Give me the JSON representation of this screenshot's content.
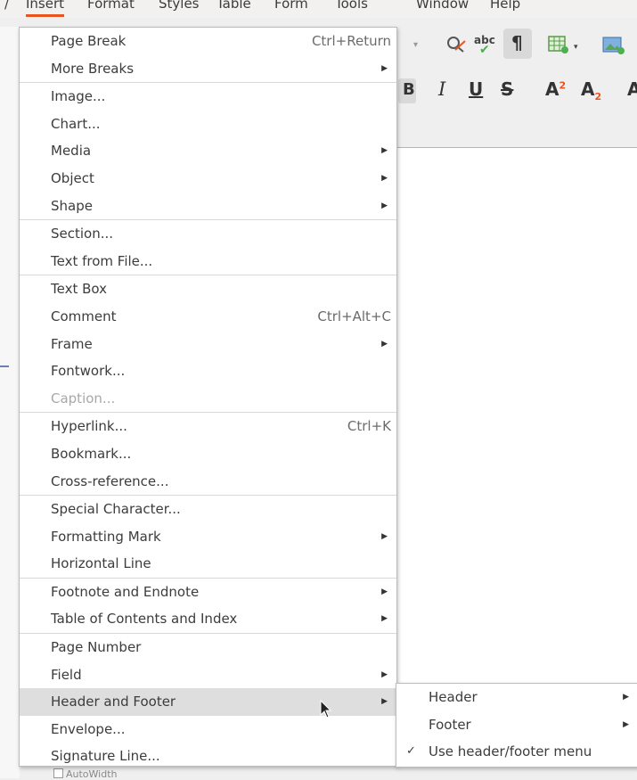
{
  "menubar": {
    "items": [
      {
        "label": "/"
      },
      {
        "label": "Insert"
      },
      {
        "label": "Format"
      },
      {
        "label": "Styles"
      },
      {
        "label": "Table"
      },
      {
        "label": "Form"
      },
      {
        "label": "Tools"
      },
      {
        "label": "Window"
      },
      {
        "label": "Help"
      }
    ]
  },
  "insert_menu": {
    "items": [
      {
        "label": "Page Break",
        "shortcut": "Ctrl+Return"
      },
      {
        "label": "More Breaks",
        "submenu": true
      },
      {
        "label": "Image..."
      },
      {
        "label": "Chart..."
      },
      {
        "label": "Media",
        "submenu": true
      },
      {
        "label": "Object",
        "submenu": true
      },
      {
        "label": "Shape",
        "submenu": true
      },
      {
        "label": "Section..."
      },
      {
        "label": "Text from File..."
      },
      {
        "label": "Text Box"
      },
      {
        "label": "Comment",
        "shortcut": "Ctrl+Alt+C"
      },
      {
        "label": "Frame",
        "submenu": true
      },
      {
        "label": "Fontwork..."
      },
      {
        "label": "Caption...",
        "disabled": true
      },
      {
        "label": "Hyperlink...",
        "shortcut": "Ctrl+K"
      },
      {
        "label": "Bookmark..."
      },
      {
        "label": "Cross-reference..."
      },
      {
        "label": "Special Character..."
      },
      {
        "label": "Formatting Mark",
        "submenu": true
      },
      {
        "label": "Horizontal Line"
      },
      {
        "label": "Footnote and Endnote",
        "submenu": true
      },
      {
        "label": "Table of Contents and Index",
        "submenu": true
      },
      {
        "label": "Page Number"
      },
      {
        "label": "Field",
        "submenu": true
      },
      {
        "label": "Header and Footer",
        "submenu": true,
        "highlighted": true
      },
      {
        "label": "Envelope..."
      },
      {
        "label": "Signature Line..."
      }
    ]
  },
  "header_footer_submenu": {
    "items": [
      {
        "label": "Header",
        "submenu": true
      },
      {
        "label": "Footer",
        "submenu": true
      },
      {
        "label": "Use header/footer menu",
        "checked": true,
        "check_mark": "✓"
      }
    ]
  },
  "toolbar": {
    "bold_label": "B",
    "italic_label": "I",
    "underline_label": "U",
    "strike_label": "S",
    "superscript_label": "A",
    "superscript_exp": "2",
    "subscript_label": "A",
    "subscript_exp": "2",
    "abc_label": "abc",
    "pilcrow_label": "¶",
    "icons": [
      "clone-formatting-icon",
      "spelling-icon",
      "formatting-marks-icon",
      "insert-table-icon",
      "insert-image-icon"
    ]
  },
  "bottom": {
    "autowidth_label": "AutoWidth"
  },
  "colors": {
    "accent": "#e95420",
    "highlight": "#dedede",
    "disabled_text": "#a8a8a8"
  }
}
